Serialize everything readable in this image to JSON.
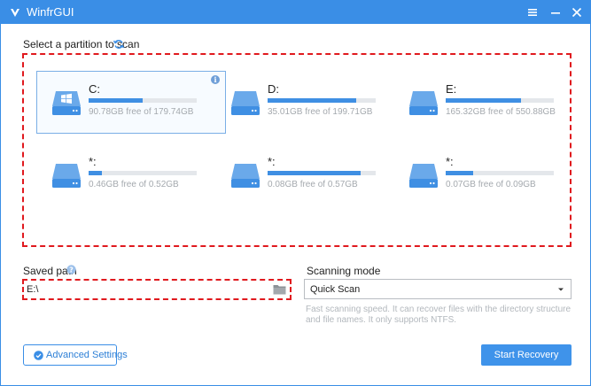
{
  "window": {
    "title": "WinfrGUI"
  },
  "partitions": {
    "label": "Select a partition to scan",
    "items": [
      {
        "letter": "C:",
        "size": "90.78GB free of 179.74GB",
        "used_fraction": 0.5,
        "selected": true
      },
      {
        "letter": "D:",
        "size": "35.01GB free of 199.71GB",
        "used_fraction": 0.82,
        "selected": false
      },
      {
        "letter": "E:",
        "size": "165.32GB free of 550.88GB",
        "used_fraction": 0.7,
        "selected": false
      },
      {
        "letter": "*:",
        "size": "0.46GB free of 0.52GB",
        "used_fraction": 0.12,
        "selected": false
      },
      {
        "letter": "*:",
        "size": "0.08GB free of 0.57GB",
        "used_fraction": 0.86,
        "selected": false
      },
      {
        "letter": "*:",
        "size": "0.07GB free of 0.09GB",
        "used_fraction": 0.25,
        "selected": false
      }
    ]
  },
  "saved_path": {
    "label": "Saved path",
    "value": "E:\\"
  },
  "scan_mode": {
    "label": "Scanning mode",
    "selected": "Quick Scan",
    "description": "Fast scanning speed. It can recover files with the directory structure and file names. It only supports NTFS."
  },
  "buttons": {
    "advanced": "Advanced Settings",
    "start": "Start Recovery"
  },
  "colors": {
    "accent": "#3a8ee6",
    "highlight": "#e0191e",
    "bar_fill": "#3f8fe3"
  }
}
